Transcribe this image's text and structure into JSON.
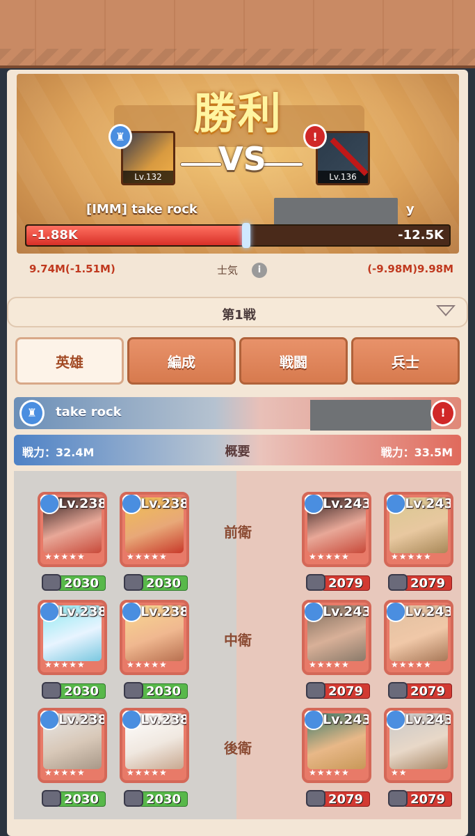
{
  "result_title": "勝利",
  "vs_label": "VS",
  "left_player": {
    "level": "Lv.132",
    "name": "[IMM] take rock",
    "damage": "-1.88K",
    "morale": "9.74M(-1.51M)"
  },
  "right_player": {
    "level": "Lv.136",
    "name_tail": "y",
    "damage": "-12.5K",
    "morale": "(-9.98M)9.98M"
  },
  "morale_label": "士気",
  "morale_info_icon": "i",
  "round_select": {
    "label": "第1戦"
  },
  "tabs": [
    {
      "label": "英雄"
    },
    {
      "label": "編成"
    },
    {
      "label": "戦闘"
    },
    {
      "label": "兵士"
    }
  ],
  "team_bar": {
    "left_name": "take rock"
  },
  "overview": {
    "left_power": "戦力：32.4M",
    "title": "概要",
    "right_power": "戦力：33.5M"
  },
  "rows": {
    "front": "前衛",
    "middle": "中衛",
    "back": "後衛"
  },
  "left_heroes": [
    {
      "level": "Lv.238",
      "power": "2030",
      "stars": "★★★★★"
    },
    {
      "level": "Lv.238",
      "power": "2030",
      "stars": "★★★★★"
    },
    {
      "level": "Lv.238",
      "power": "2030",
      "stars": "★★★★★"
    },
    {
      "level": "Lv.238",
      "power": "2030",
      "stars": "★★★★★"
    },
    {
      "level": "Lv.238",
      "power": "2030",
      "stars": "★★★★★"
    },
    {
      "level": "Lv.238",
      "power": "2030",
      "stars": "★★★★★"
    }
  ],
  "right_heroes": [
    {
      "level": "Lv.243",
      "power": "2079",
      "stars": "★★★★★"
    },
    {
      "level": "Lv.243",
      "power": "2079",
      "stars": "★★★★★"
    },
    {
      "level": "Lv.243",
      "power": "2079",
      "stars": "★★★★★"
    },
    {
      "level": "Lv.243",
      "power": "2079",
      "stars": "★★★★★"
    },
    {
      "level": "Lv.243",
      "power": "2079",
      "stars": "★★★★★"
    },
    {
      "level": "Lv.243",
      "power": "2079",
      "stars": "★★"
    }
  ],
  "colors": {
    "ally": "#4a8ee0",
    "enemy": "#d02828",
    "tab_active_text": "#a24a24",
    "tab_bg": "#d77a4e"
  }
}
